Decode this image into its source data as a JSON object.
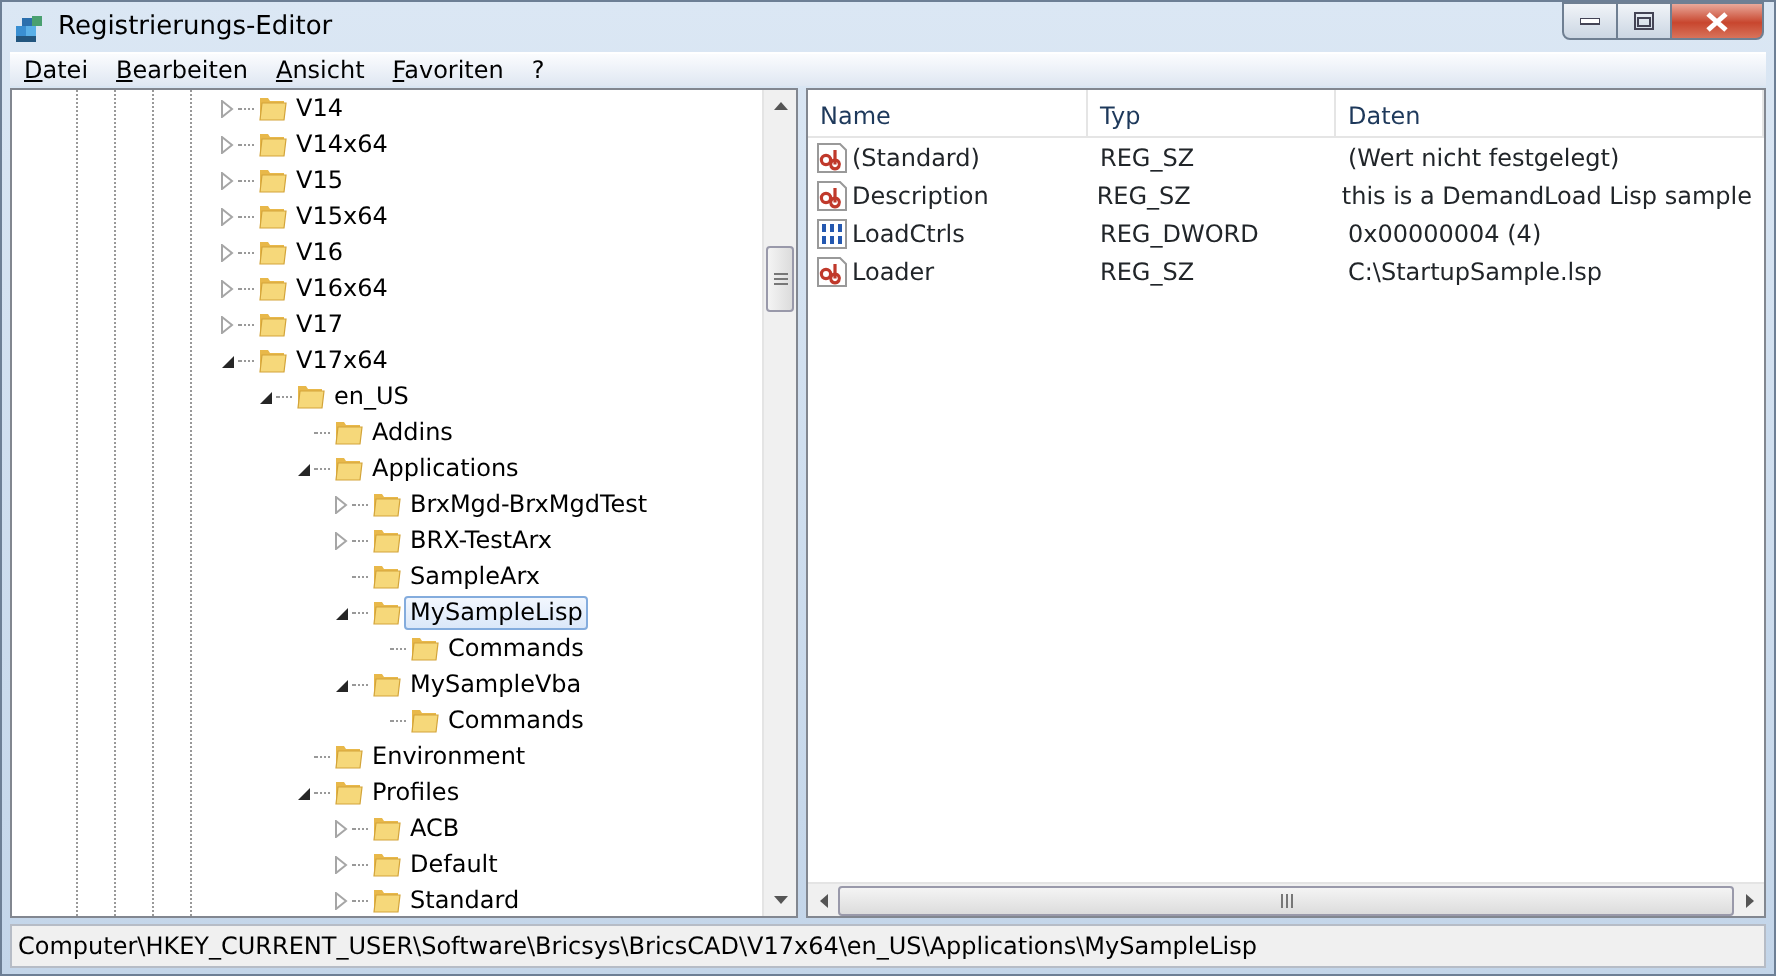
{
  "window": {
    "title": "Registrierungs-Editor"
  },
  "menu": [
    "Datei",
    "Bearbeiten",
    "Ansicht",
    "Favoriten",
    "?"
  ],
  "tree": [
    {
      "label": "V14",
      "expanded": false,
      "selected": false
    },
    {
      "label": "V14x64",
      "expanded": false,
      "selected": false
    },
    {
      "label": "V15",
      "expanded": false,
      "selected": false
    },
    {
      "label": "V15x64",
      "expanded": false,
      "selected": false
    },
    {
      "label": "V16",
      "expanded": false,
      "selected": false
    },
    {
      "label": "V16x64",
      "expanded": false,
      "selected": false
    },
    {
      "label": "V17",
      "expanded": false,
      "selected": false
    },
    {
      "label": "V17x64",
      "expanded": true,
      "selected": false,
      "children": [
        {
          "label": "en_US",
          "expanded": true,
          "selected": false,
          "children": [
            {
              "label": "Addins",
              "selected": false
            },
            {
              "label": "Applications",
              "expanded": true,
              "selected": false,
              "children": [
                {
                  "label": "BrxMgd-BrxMgdTest",
                  "expanded": false,
                  "selected": false
                },
                {
                  "label": "BRX-TestArx",
                  "expanded": false,
                  "selected": false
                },
                {
                  "label": "SampleArx",
                  "selected": false
                },
                {
                  "label": "MySampleLisp",
                  "expanded": true,
                  "selected": true,
                  "children": [
                    {
                      "label": "Commands",
                      "selected": false
                    }
                  ]
                },
                {
                  "label": "MySampleVba",
                  "expanded": true,
                  "selected": false,
                  "children": [
                    {
                      "label": "Commands",
                      "selected": false
                    }
                  ]
                }
              ]
            },
            {
              "label": "Environment",
              "selected": false
            },
            {
              "label": "Profiles",
              "expanded": true,
              "selected": false,
              "children": [
                {
                  "label": "ACB",
                  "expanded": false,
                  "selected": false
                },
                {
                  "label": "Default",
                  "expanded": false,
                  "selected": false
                },
                {
                  "label": "Standard",
                  "expanded": false,
                  "selected": false
                }
              ]
            }
          ]
        }
      ]
    }
  ],
  "values": {
    "columns": [
      "Name",
      "Typ",
      "Daten"
    ],
    "rows": [
      {
        "kind": "string",
        "name": "(Standard)",
        "type": "REG_SZ",
        "data": "(Wert nicht festgelegt)"
      },
      {
        "kind": "string",
        "name": "Description",
        "type": "REG_SZ",
        "data": "this is a DemandLoad Lisp sample"
      },
      {
        "kind": "binary",
        "name": "LoadCtrls",
        "type": "REG_DWORD",
        "data": "0x00000004 (4)"
      },
      {
        "kind": "string",
        "name": "Loader",
        "type": "REG_SZ",
        "data": "C:\\StartupSample.lsp"
      }
    ]
  },
  "status_bar": "Computer\\HKEY_CURRENT_USER\\Software\\Bricsys\\BricsCAD\\V17x64\\en_US\\Applications\\MySampleLisp"
}
